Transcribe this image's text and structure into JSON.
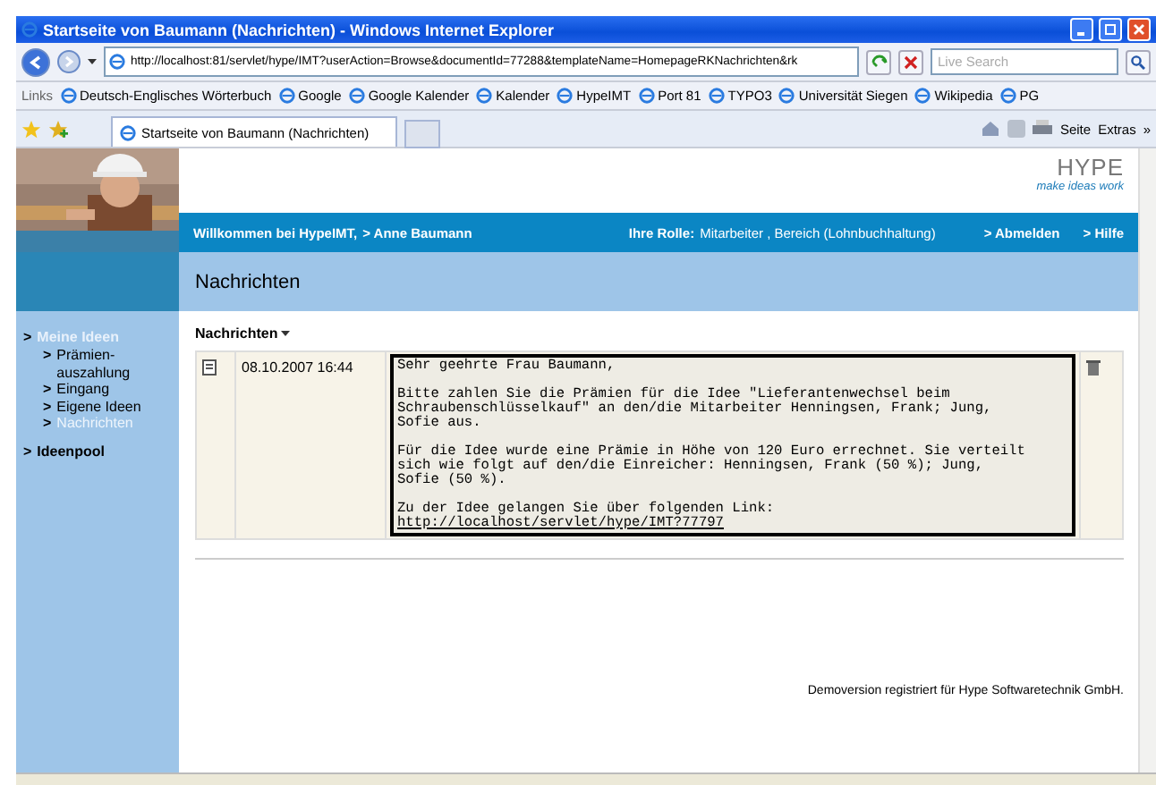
{
  "window": {
    "title": "Startseite von Baumann (Nachrichten) - Windows Internet Explorer"
  },
  "address": {
    "value": "http://localhost:81/servlet/hype/IMT?userAction=Browse&documentId=77288&templateName=HomepageRKNachrichten&rk"
  },
  "search": {
    "placeholder": "Live Search"
  },
  "links": {
    "label": "Links",
    "items": [
      "Deutsch-Englisches Wörterbuch",
      "Google",
      "Google Kalender",
      "Kalender",
      "HypeIMT",
      "Port 81",
      "TYPO3",
      "Universität Siegen",
      "Wikipedia",
      "PG"
    ]
  },
  "tab": {
    "title": "Startseite von Baumann (Nachrichten)"
  },
  "command_bar": {
    "page": "Seite",
    "tools": "Extras",
    "more": "»"
  },
  "page": {
    "logo": {
      "name": "HYPE",
      "slogan": "make ideas work"
    },
    "bar": {
      "welcome": "Willkommen bei HypeIMT,",
      "user": "> Anne Baumann",
      "role_label": "Ihre Rolle:",
      "role": "Mitarbeiter , Bereich (Lohnbuchhaltung)",
      "logout": "> Abmelden",
      "help": "> Hilfe"
    },
    "heading": "Nachrichten",
    "sidebar": [
      {
        "marker": ">",
        "label": "Meine Ideen",
        "selected": true,
        "children": [
          {
            "marker": ">",
            "label": "Prämien-\nauszahlung",
            "selected": false
          },
          {
            "marker": ">",
            "label": "Eingang",
            "selected": false
          },
          {
            "marker": ">",
            "label": "Eigene Ideen",
            "selected": false
          },
          {
            "marker": ">",
            "label": "Nachrichten",
            "selected": true
          }
        ]
      },
      {
        "marker": ">",
        "label": "Ideenpool",
        "selected": false
      }
    ],
    "section_title": "Nachrichten",
    "messages": [
      {
        "date": "08.10.2007 16:44",
        "paragraphs": [
          "Sehr geehrte Frau Baumann,",
          "Bitte zahlen Sie die Prämien für die Idee \"Lieferantenwechsel beim\nSchraubenschlüsselkauf\" an den/die Mitarbeiter Henningsen, Frank; Jung,\nSofie aus.",
          "Für die Idee wurde eine Prämie in Höhe von 120 Euro errechnet. Sie verteilt\nsich wie folgt auf den/die Einreicher: Henningsen, Frank (50 %); Jung,\nSofie (50 %).",
          "Zu der Idee gelangen Sie über folgenden Link:"
        ],
        "link": "http://localhost/servlet/hype/IMT?77797"
      }
    ],
    "footer": "Demoversion registriert für Hype Softwaretechnik GmbH."
  }
}
